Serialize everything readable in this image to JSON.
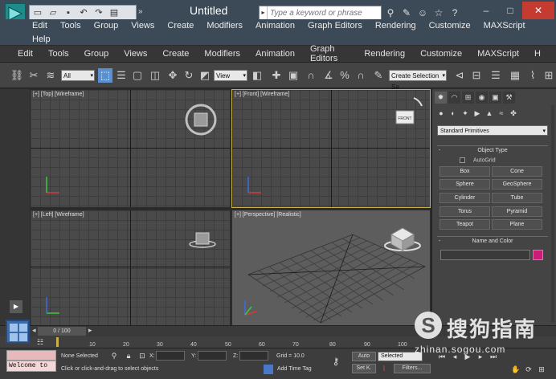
{
  "window": {
    "title": "Untitled",
    "search_placeholder": "Type a keyword or phrase",
    "title_icons": [
      "binoculars-icon",
      "wrench-icon",
      "user-icon",
      "star-icon",
      "help-icon"
    ],
    "help_symbol": "?",
    "minimize_symbol": "–",
    "maximize_symbol": "□",
    "close_symbol": "✕"
  },
  "quick_access": [
    "new-icon",
    "open-icon",
    "save-icon",
    "undo-icon",
    "redo-icon",
    "project-icon"
  ],
  "menu_top": {
    "items": [
      "Edit",
      "Tools",
      "Group",
      "Views",
      "Create",
      "Modifiers",
      "Animation",
      "Graph Editors",
      "Rendering",
      "Customize",
      "MAXScript"
    ],
    "help": "Help"
  },
  "menu_main": {
    "items": [
      "Edit",
      "Tools",
      "Group",
      "Views",
      "Create",
      "Modifiers",
      "Animation",
      "Graph Editors",
      "Rendering",
      "Customize",
      "MAXScript",
      "H"
    ]
  },
  "toolbar": {
    "filter_value": "All",
    "refcoord_value": "View",
    "selection_set_placeholder": "Create Selection Se"
  },
  "viewports": {
    "top": "[+] [Top] [Wireframe]",
    "front": "[+] [Front] [Wireframe]",
    "left": "[+] [Left] [Wireframe]",
    "perspective": "[+] [Perspective] [Realistic]",
    "viewcube_front_label": "FRONT"
  },
  "command_panel": {
    "category": "Standard Primitives",
    "object_type_title": "Object Type",
    "autogrid_label": "AutoGrid",
    "buttons": [
      "Box",
      "Cone",
      "Sphere",
      "GeoSphere",
      "Cylinder",
      "Tube",
      "Torus",
      "Pyramid",
      "Teapot",
      "Plane"
    ],
    "name_color_title": "Name and Color",
    "rollout_symbol": "-",
    "color": "#c81e7a"
  },
  "timeline": {
    "frame_display": "0 / 100",
    "ticks": [
      "0",
      "10",
      "20",
      "30",
      "40",
      "50",
      "60",
      "70",
      "80",
      "90",
      "100"
    ]
  },
  "status": {
    "welcome": "Welcome to",
    "selection": "None Selected",
    "prompt": "Click or click-and-drag to select objects",
    "x_label": "X:",
    "y_label": "Y:",
    "z_label": "Z:",
    "grid": "Grid = 10.0",
    "add_time_tag": "Add Time Tag",
    "auto_btn": "Auto",
    "selected_value": "Selected",
    "set_key": "Set K.",
    "filters": "Filters..."
  },
  "watermark": {
    "brand": "搜狗指南",
    "url": "zhinan.sogou.com"
  }
}
